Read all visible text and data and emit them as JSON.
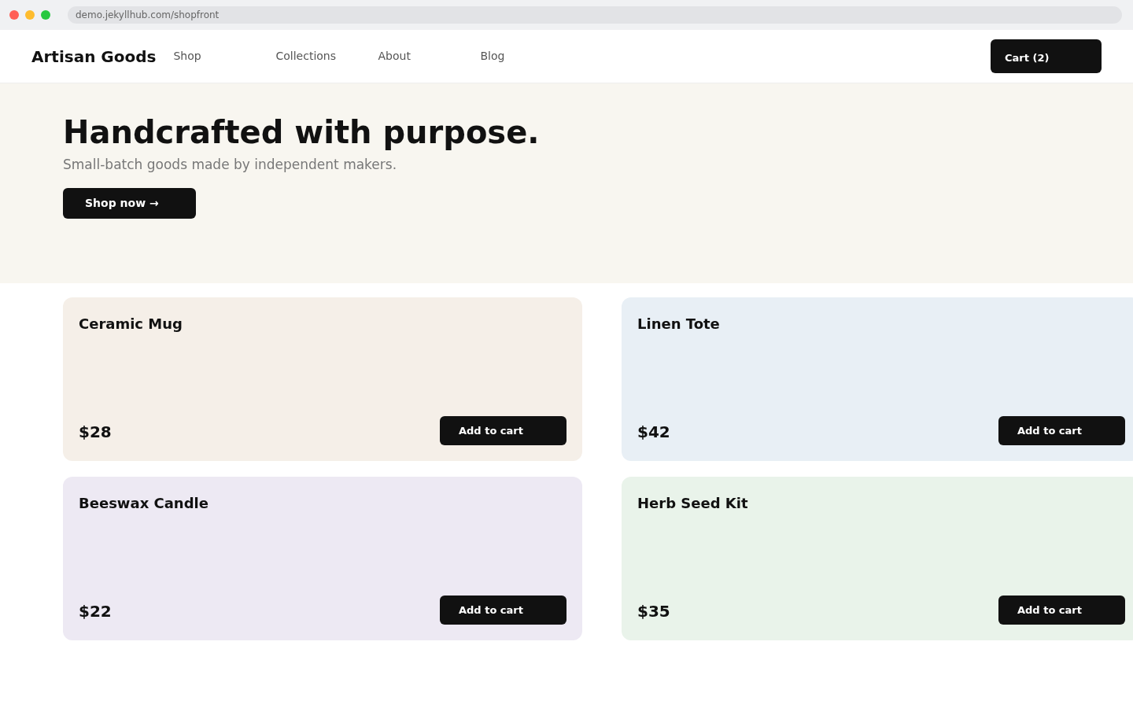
{
  "browser": {
    "url": "demo.jekyllhub.com/shopfront"
  },
  "header": {
    "logo": "Artisan Goods",
    "nav": [
      "Shop",
      "Collections",
      "About",
      "Blog"
    ],
    "cart_button": "Cart (2)"
  },
  "hero": {
    "title": "Handcrafted with purpose.",
    "subtitle": "Small-batch goods made by independent makers.",
    "button": "Shop now →"
  },
  "products": [
    {
      "name": "Ceramic Mug",
      "price": "$28",
      "button": "Add to cart",
      "color": "#f5efe8"
    },
    {
      "name": "Linen Tote",
      "price": "$42",
      "button": "Add to cart",
      "color": "#e8eff5"
    },
    {
      "name": "Beeswax Candle",
      "price": "$22",
      "button": "Add to cart",
      "color": "#ede9f3"
    },
    {
      "name": "Herb Seed Kit",
      "price": "$35",
      "button": "Add to cart",
      "color": "#e9f3ea"
    }
  ]
}
